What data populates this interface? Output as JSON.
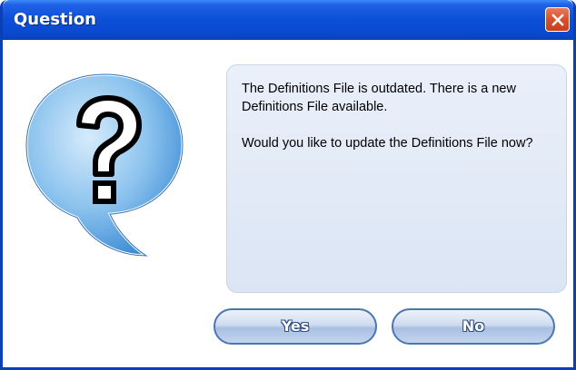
{
  "window": {
    "title": "Question"
  },
  "icons": {
    "close": "close-icon",
    "question": "question-bubble-icon"
  },
  "message": {
    "line1": "The Definitions File is outdated. There is a new Definitions File available.",
    "line2": "Would you like to update the Definitions File now?"
  },
  "buttons": {
    "yes": "Yes",
    "no": "No"
  },
  "colors": {
    "titlebar": "#0c4fd7",
    "close_button": "#d9502c",
    "panel": "#dbe5f4",
    "button_border": "#4b76b4"
  }
}
